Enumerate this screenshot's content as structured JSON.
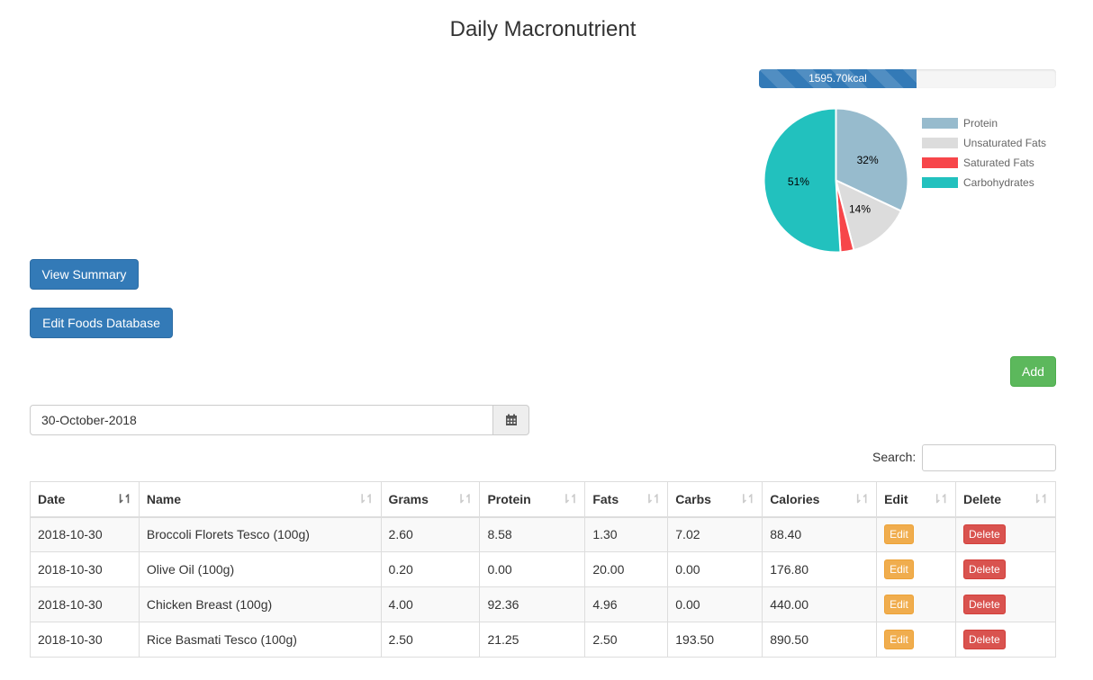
{
  "page": {
    "title": "Daily Macronutrient"
  },
  "progress": {
    "label": "1595.70kcal",
    "percent": 53
  },
  "chart_data": {
    "type": "pie",
    "categories": [
      "Protein",
      "Unsaturated Fats",
      "Saturated Fats",
      "Carbohydrates"
    ],
    "values": [
      32,
      14,
      3,
      51
    ],
    "data_labels": [
      "32%",
      "14%",
      "",
      "51%"
    ],
    "colors": [
      "#97bbcd",
      "#dcdcdc",
      "#f7464a",
      "#22c1be"
    ],
    "legend": "right"
  },
  "buttons": {
    "view_summary": "View Summary",
    "edit_foods": "Edit Foods Database",
    "add": "Add"
  },
  "date_picker": {
    "value": "30-October-2018",
    "icon": "calendar-icon"
  },
  "search": {
    "label": "Search:",
    "value": ""
  },
  "table": {
    "headers": [
      "Date",
      "Name",
      "Grams",
      "Protein",
      "Fats",
      "Carbs",
      "Calories",
      "Edit",
      "Delete"
    ],
    "rows": [
      {
        "date": "2018-10-30",
        "name": "Broccoli Florets Tesco (100g)",
        "grams": "2.60",
        "protein": "8.58",
        "fats": "1.30",
        "carbs": "7.02",
        "calories": "88.40",
        "edit": "Edit",
        "delete": "Delete"
      },
      {
        "date": "2018-10-30",
        "name": "Olive Oil (100g)",
        "grams": "0.20",
        "protein": "0.00",
        "fats": "20.00",
        "carbs": "0.00",
        "calories": "176.80",
        "edit": "Edit",
        "delete": "Delete"
      },
      {
        "date": "2018-10-30",
        "name": "Chicken Breast (100g)",
        "grams": "4.00",
        "protein": "92.36",
        "fats": "4.96",
        "carbs": "0.00",
        "calories": "440.00",
        "edit": "Edit",
        "delete": "Delete"
      },
      {
        "date": "2018-10-30",
        "name": "Rice Basmati Tesco (100g)",
        "grams": "2.50",
        "protein": "21.25",
        "fats": "2.50",
        "carbs": "193.50",
        "calories": "890.50",
        "edit": "Edit",
        "delete": "Delete"
      }
    ]
  }
}
